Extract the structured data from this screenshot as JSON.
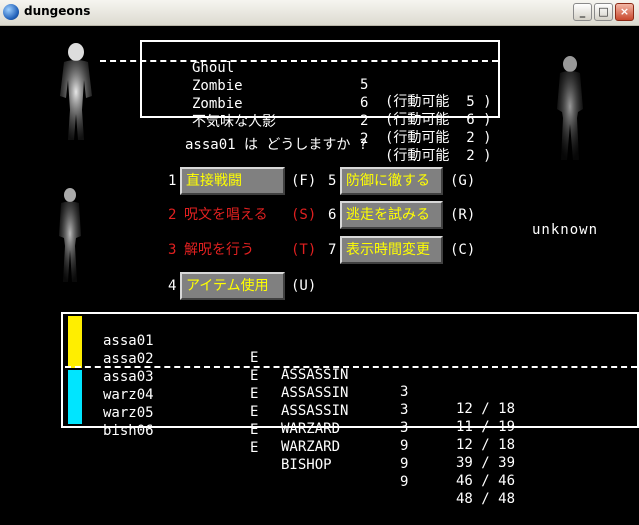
{
  "window": {
    "title": "dungeons",
    "min": "_",
    "max": "□",
    "close": "×"
  },
  "monsters": [
    {
      "name": "Ghoul",
      "count": "5",
      "status": "(行動可能  5 )"
    },
    {
      "name": "Zombie",
      "count": "6",
      "status": "(行動可能  6 )"
    },
    {
      "name": "Zombie",
      "count": "2",
      "status": "(行動可能  2 )"
    },
    {
      "name": "不気味な人影",
      "count": "2",
      "status": "(行動可能  2 )"
    }
  ],
  "prompt": "assa01 は どうしますか ?",
  "commands": {
    "fight": {
      "num": "1",
      "label": "直接戦闘",
      "key": "(F)"
    },
    "spell": {
      "num": "2",
      "label": "呪文を唱える",
      "key": "(S)"
    },
    "dispel": {
      "num": "3",
      "label": "解呪を行う",
      "key": "(T)"
    },
    "item": {
      "num": "4",
      "label": "アイテム使用",
      "key": "(U)"
    },
    "parry": {
      "num": "5",
      "label": "防御に徹する",
      "key": "(G)"
    },
    "run": {
      "num": "6",
      "label": "逃走を試みる",
      "key": "(R)"
    },
    "time": {
      "num": "7",
      "label": "表示時間変更",
      "key": "(C)"
    }
  },
  "unknown_label": "unknown",
  "party": [
    {
      "name": "assa01",
      "align": "E",
      "class": "ASSASSIN",
      "level": "3",
      "hp": "12 / 18"
    },
    {
      "name": "assa02",
      "align": "E",
      "class": "ASSASSIN",
      "level": "3",
      "hp": "11 / 19"
    },
    {
      "name": "assa03",
      "align": "E",
      "class": "ASSASSIN",
      "level": "3",
      "hp": "12 / 18"
    },
    {
      "name": "warz04",
      "align": "E",
      "class": "WARZARD",
      "level": "9",
      "hp": "39 / 39"
    },
    {
      "name": "warz05",
      "align": "E",
      "class": "WARZARD",
      "level": "9",
      "hp": "46 / 46"
    },
    {
      "name": "bish06",
      "align": "E",
      "class": "BISHOP",
      "level": "9",
      "hp": "48 / 48"
    }
  ],
  "colors": {
    "command_text": "#ffff00",
    "disabled_text": "#e02020",
    "front_row": "#ffee00",
    "back_row": "#00e5ff",
    "button_face": "#808080"
  }
}
